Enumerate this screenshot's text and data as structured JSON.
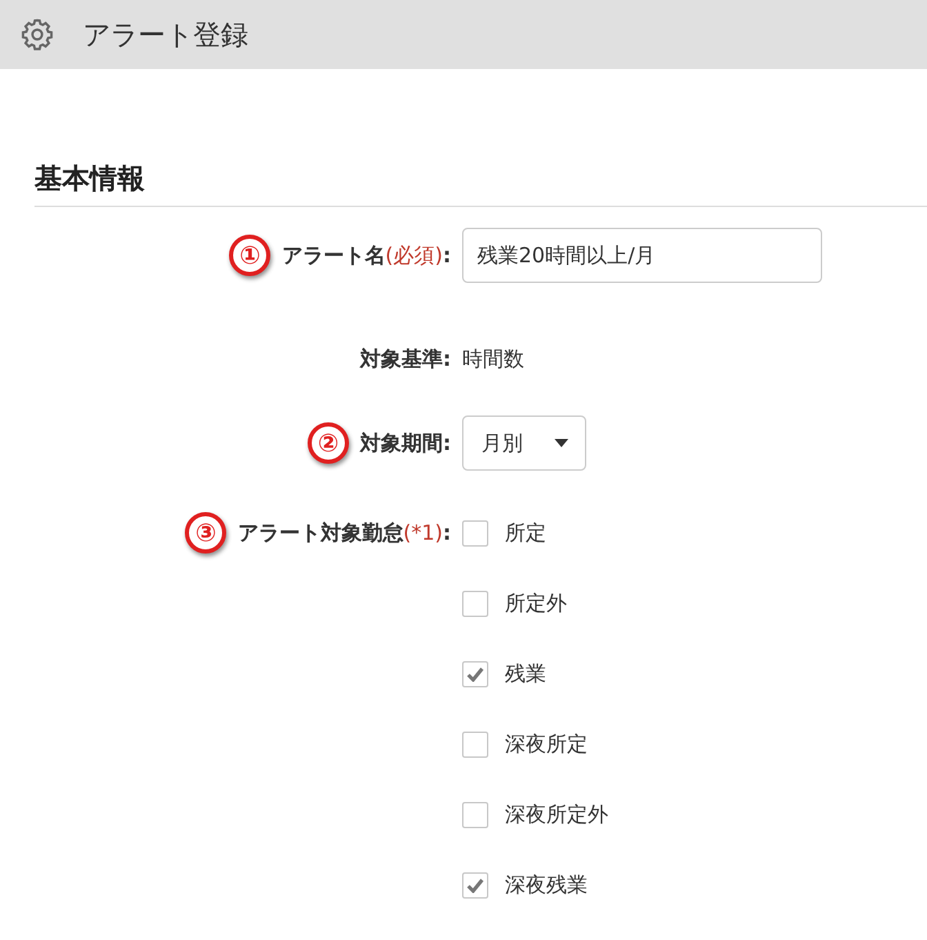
{
  "header": {
    "title": "アラート登録"
  },
  "section": {
    "title": "基本情報"
  },
  "fields": [
    {
      "kind": "text-input",
      "marker": "①",
      "label": "アラート名",
      "note": "(必須)",
      "colon": ":",
      "value": "残業20時間以上/月"
    },
    {
      "kind": "static",
      "label": "対象基準",
      "colon": ":",
      "value": "時間数"
    },
    {
      "kind": "select",
      "marker": "②",
      "label": "対象期間",
      "colon": ":",
      "value": "月別"
    },
    {
      "kind": "checkboxes",
      "marker": "③",
      "label": "アラート対象勤怠",
      "note": "(*1)",
      "colon": ":",
      "options": [
        {
          "label": "所定",
          "checked": false
        },
        {
          "label": "所定外",
          "checked": false
        },
        {
          "label": "残業",
          "checked": true
        },
        {
          "label": "深夜所定",
          "checked": false
        },
        {
          "label": "深夜所定外",
          "checked": false
        },
        {
          "label": "深夜残業",
          "checked": true
        }
      ]
    }
  ]
}
